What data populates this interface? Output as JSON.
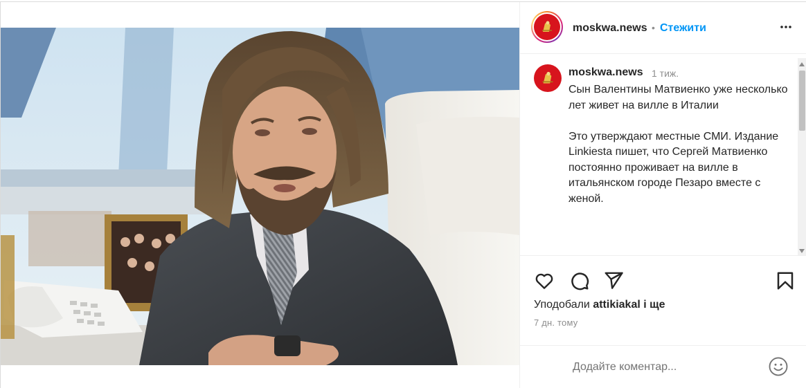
{
  "post": {
    "username": "moskwa.news",
    "separator": "•",
    "follow_label": "Стежити",
    "more_icon": "more-horizontal-icon"
  },
  "caption": {
    "username": "moskwa.news",
    "time": "1 тиж.",
    "paragraph1": "Сын Валентины Матвиенко уже несколько лет живет на вилле в Италии",
    "paragraph2": "Это утверждают местные СМИ. Издание Linkiesta пишет, что Сергей Матвиенко постоянно проживает на вилле в итальянском городе Пезаро вместе с женой."
  },
  "actions": {
    "like_icon": "heart-icon",
    "comment_icon": "comment-icon",
    "share_icon": "send-icon",
    "save_icon": "bookmark-icon"
  },
  "likes": {
    "prefix": "Уподобали",
    "user": "attikiakal",
    "suffix": "і ще"
  },
  "date": "7 дн. тому",
  "comment": {
    "placeholder": "Додайте коментар...",
    "emoji_icon": "emoji-icon"
  },
  "colors": {
    "accent": "#0095f6",
    "avatar_red": "#d7141d",
    "text": "#262626",
    "muted": "#8e8e8e"
  }
}
